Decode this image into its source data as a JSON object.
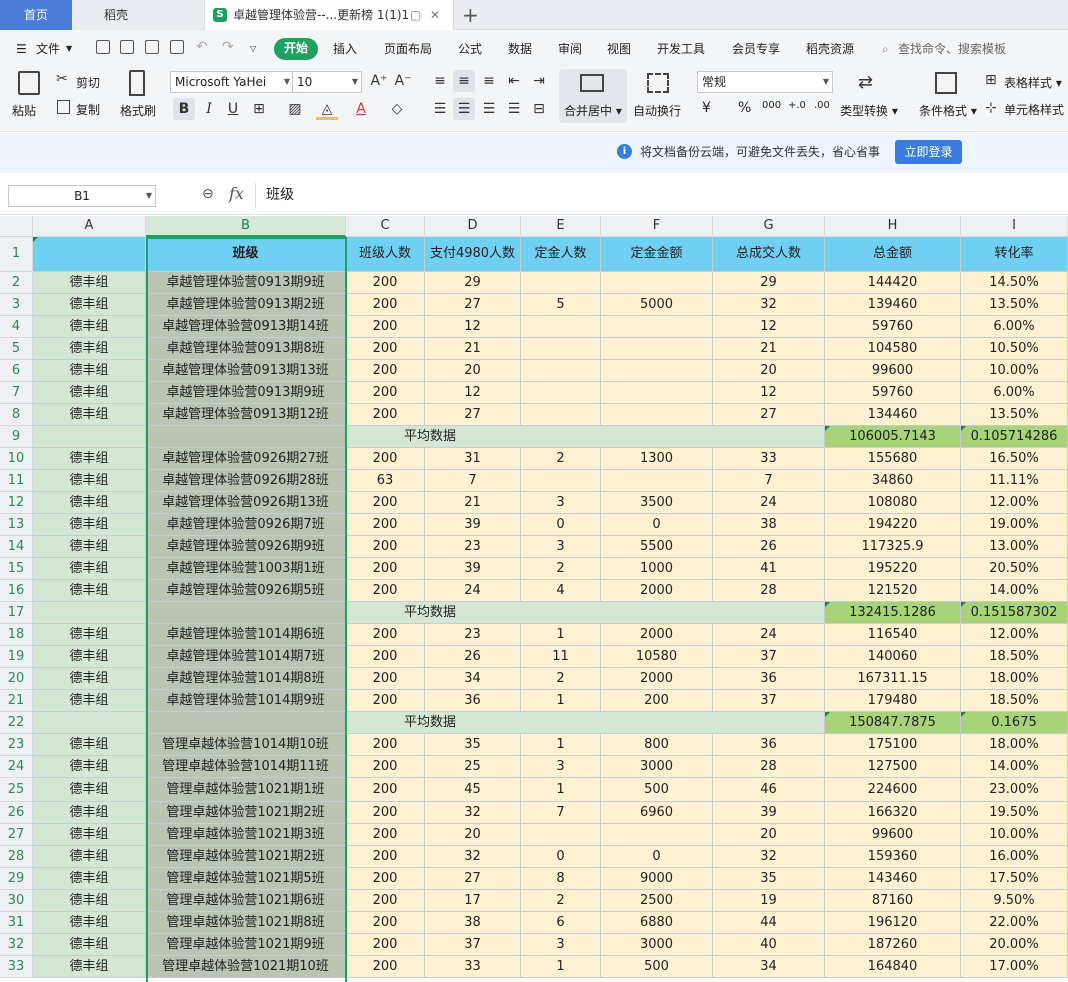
{
  "tabs": {
    "home": "首页",
    "daoke": "稻壳",
    "doc": "卓越管理体验营--...更新榜 1(1)1"
  },
  "menubar": {
    "file": "文件",
    "items": [
      "开始",
      "插入",
      "页面布局",
      "公式",
      "数据",
      "审阅",
      "视图",
      "开发工具",
      "会员专享",
      "稻壳资源"
    ],
    "search": "查找命令、搜索模板"
  },
  "ribbon": {
    "paste": "粘贴",
    "cut": "剪切",
    "copy": "复制",
    "format_painter": "格式刷",
    "font": "Microsoft YaHei",
    "size": "10",
    "merge_center": "合并居中",
    "wrap": "自动换行",
    "number_format": "常规",
    "type_convert": "类型转换",
    "cond_format": "条件格式",
    "table_style": "表格样式",
    "cell_style": "单元格样式",
    "yen": "¥",
    "percent": "%",
    "thousands": "000",
    "dec_inc": "+.0",
    "dec_dec": ".00"
  },
  "banner": {
    "text": "将文档备份云端，可避免文件丢失，省心省事",
    "button": "立即登录"
  },
  "formula": {
    "cell_ref": "B1",
    "content": "班级"
  },
  "columns": [
    "A",
    "B",
    "C",
    "D",
    "E",
    "F",
    "G",
    "H",
    "I"
  ],
  "header_row": [
    "",
    "班级",
    "班级人数",
    "支付4980人数",
    "定金人数",
    "定金金额",
    "总成交人数",
    "总金额",
    "转化率"
  ],
  "rows": [
    {
      "n": "2",
      "t": "d",
      "c": [
        "德丰组",
        "卓越管理体验营0913期9班",
        "200",
        "29",
        "",
        "",
        "29",
        "144420",
        "14.50%"
      ]
    },
    {
      "n": "3",
      "t": "d",
      "c": [
        "德丰组",
        "卓越管理体验营0913期2班",
        "200",
        "27",
        "5",
        "5000",
        "32",
        "139460",
        "13.50%"
      ]
    },
    {
      "n": "4",
      "t": "d",
      "c": [
        "德丰组",
        "卓越管理体验营0913期14班",
        "200",
        "12",
        "",
        "",
        "12",
        "59760",
        "6.00%"
      ]
    },
    {
      "n": "5",
      "t": "d",
      "c": [
        "德丰组",
        "卓越管理体验营0913期8班",
        "200",
        "21",
        "",
        "",
        "21",
        "104580",
        "10.50%"
      ]
    },
    {
      "n": "6",
      "t": "d",
      "c": [
        "德丰组",
        "卓越管理体验营0913期13班",
        "200",
        "20",
        "",
        "",
        "20",
        "99600",
        "10.00%"
      ]
    },
    {
      "n": "7",
      "t": "d",
      "c": [
        "德丰组",
        "卓越管理体验营0913期9班",
        "200",
        "12",
        "",
        "",
        "12",
        "59760",
        "6.00%"
      ]
    },
    {
      "n": "8",
      "t": "d",
      "c": [
        "德丰组",
        "卓越管理体验营0913期12班",
        "200",
        "27",
        "",
        "",
        "27",
        "134460",
        "13.50%"
      ]
    },
    {
      "n": "9",
      "t": "a",
      "label": "平均数据",
      "h": "106005.7143",
      "i": "0.105714286"
    },
    {
      "n": "10",
      "t": "d",
      "c": [
        "德丰组",
        "卓越管理体验营0926期27班",
        "200",
        "31",
        "2",
        "1300",
        "33",
        "155680",
        "16.50%"
      ]
    },
    {
      "n": "11",
      "t": "d",
      "c": [
        "德丰组",
        "卓越管理体验营0926期28班",
        "63",
        "7",
        "",
        "",
        "7",
        "34860",
        "11.11%"
      ]
    },
    {
      "n": "12",
      "t": "d",
      "c": [
        "德丰组",
        "卓越管理体验营0926期13班",
        "200",
        "21",
        "3",
        "3500",
        "24",
        "108080",
        "12.00%"
      ]
    },
    {
      "n": "13",
      "t": "d",
      "c": [
        "德丰组",
        "卓越管理体验营0926期7班",
        "200",
        "39",
        "0",
        "0",
        "38",
        "194220",
        "19.00%"
      ]
    },
    {
      "n": "14",
      "t": "d",
      "c": [
        "德丰组",
        "卓越管理体验营0926期9班",
        "200",
        "23",
        "3",
        "5500",
        "26",
        "117325.9",
        "13.00%"
      ]
    },
    {
      "n": "15",
      "t": "d",
      "c": [
        "德丰组",
        "卓越管理体验营1003期1班",
        "200",
        "39",
        "2",
        "1000",
        "41",
        "195220",
        "20.50%"
      ]
    },
    {
      "n": "16",
      "t": "d",
      "c": [
        "德丰组",
        "卓越管理体验营0926期5班",
        "200",
        "24",
        "4",
        "2000",
        "28",
        "121520",
        "14.00%"
      ]
    },
    {
      "n": "17",
      "t": "a",
      "label": "平均数据",
      "h": "132415.1286",
      "i": "0.151587302"
    },
    {
      "n": "18",
      "t": "d",
      "c": [
        "德丰组",
        "卓越管理体验营1014期6班",
        "200",
        "23",
        "1",
        "2000",
        "24",
        "116540",
        "12.00%"
      ]
    },
    {
      "n": "19",
      "t": "d",
      "c": [
        "德丰组",
        "卓越管理体验营1014期7班",
        "200",
        "26",
        "11",
        "10580",
        "37",
        "140060",
        "18.50%"
      ]
    },
    {
      "n": "20",
      "t": "d",
      "c": [
        "德丰组",
        "卓越管理体验营1014期8班",
        "200",
        "34",
        "2",
        "2000",
        "36",
        "167311.15",
        "18.00%"
      ]
    },
    {
      "n": "21",
      "t": "d",
      "c": [
        "德丰组",
        "卓越管理体验营1014期9班",
        "200",
        "36",
        "1",
        "200",
        "37",
        "179480",
        "18.50%"
      ]
    },
    {
      "n": "22",
      "t": "a",
      "label": "平均数据",
      "h": "150847.7875",
      "i": "0.1675"
    },
    {
      "n": "23",
      "t": "d",
      "c": [
        "德丰组",
        "管理卓越体验营1014期10班",
        "200",
        "35",
        "1",
        "800",
        "36",
        "175100",
        "18.00%"
      ]
    },
    {
      "n": "24",
      "t": "d",
      "c": [
        "德丰组",
        "管理卓越体验营1014期11班",
        "200",
        "25",
        "3",
        "3000",
        "28",
        "127500",
        "14.00%"
      ]
    },
    {
      "n": "25",
      "t": "d",
      "c": [
        "德丰组",
        "管理卓越体验营1021期1班",
        "200",
        "45",
        "1",
        "500",
        "46",
        "224600",
        "23.00%"
      ]
    },
    {
      "n": "26",
      "t": "d",
      "c": [
        "德丰组",
        "管理卓越体验营1021期2班",
        "200",
        "32",
        "7",
        "6960",
        "39",
        "166320",
        "19.50%"
      ]
    },
    {
      "n": "27",
      "t": "d",
      "c": [
        "德丰组",
        "管理卓越体验营1021期3班",
        "200",
        "20",
        "",
        "",
        "20",
        "99600",
        "10.00%"
      ]
    },
    {
      "n": "28",
      "t": "d",
      "c": [
        "德丰组",
        "管理卓越体验营1021期2班",
        "200",
        "32",
        "0",
        "0",
        "32",
        "159360",
        "16.00%"
      ]
    },
    {
      "n": "29",
      "t": "d",
      "c": [
        "德丰组",
        "管理卓越体验营1021期5班",
        "200",
        "27",
        "8",
        "9000",
        "35",
        "143460",
        "17.50%"
      ]
    },
    {
      "n": "30",
      "t": "d",
      "c": [
        "德丰组",
        "管理卓越体验营1021期6班",
        "200",
        "17",
        "2",
        "2500",
        "19",
        "87160",
        "9.50%"
      ]
    },
    {
      "n": "31",
      "t": "d",
      "c": [
        "德丰组",
        "管理卓越体验营1021期8班",
        "200",
        "38",
        "6",
        "6880",
        "44",
        "196120",
        "22.00%"
      ]
    },
    {
      "n": "32",
      "t": "d",
      "c": [
        "德丰组",
        "管理卓越体验营1021期9班",
        "200",
        "37",
        "3",
        "3000",
        "40",
        "187260",
        "20.00%"
      ]
    },
    {
      "n": "33",
      "t": "d",
      "c": [
        "德丰组",
        "管理卓越体验营1021期10班",
        "200",
        "33",
        "1",
        "500",
        "34",
        "164840",
        "17.00%"
      ]
    }
  ],
  "colors": {
    "accent": "#20a162",
    "header": "#6fd0f2",
    "data": "#fdf1d2",
    "group": "#d4e7d4",
    "class": "#b9c4b5",
    "avg": "#a8d479"
  }
}
